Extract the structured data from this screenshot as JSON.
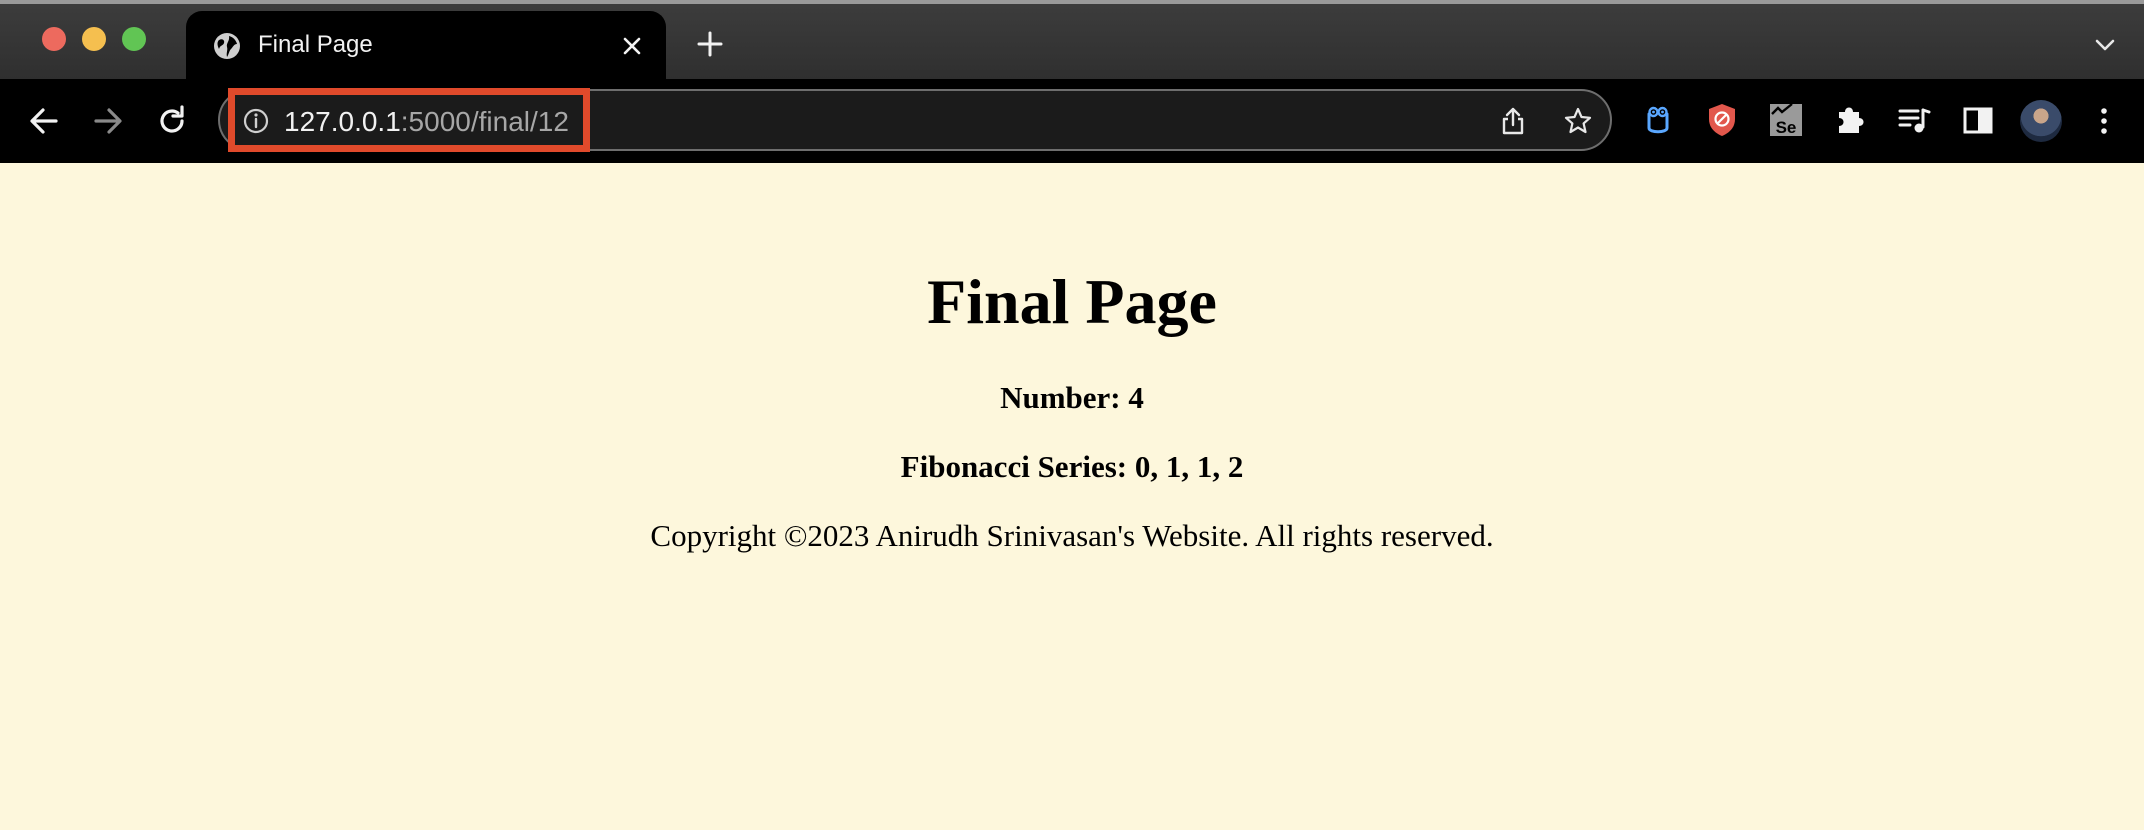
{
  "browser": {
    "tab": {
      "title": "Final Page"
    },
    "address_bar": {
      "host": "127.0.0.1",
      "path": ":5000/final/12"
    }
  },
  "page": {
    "heading": "Final Page",
    "number_label": "Number:",
    "number_value": "4",
    "fib_label": "Fibonacci Series:",
    "fib_value": "0, 1, 1, 2",
    "copyright": "Copyright ©2023 Anirudh Srinivasan's Website. All rights reserved."
  },
  "icons": {
    "tab": "globe-icon",
    "close": "close-icon",
    "new_tab": "plus-icon",
    "tab_list": "chevron-down-icon",
    "back": "arrow-left-icon",
    "forward": "arrow-right-icon",
    "reload": "reload-icon",
    "site_info": "info-icon",
    "share": "share-icon",
    "bookmark": "star-icon",
    "extensions": [
      "owl-extension-icon",
      "shield-extension-icon",
      "selenium-extension-icon",
      "puzzle-icon",
      "media-controls-icon",
      "side-panel-icon"
    ],
    "menu": "kebab-icon"
  },
  "colors": {
    "page_background": "#fdf7dc",
    "annotation": "#e04a2b",
    "toolbar": "#000000"
  }
}
